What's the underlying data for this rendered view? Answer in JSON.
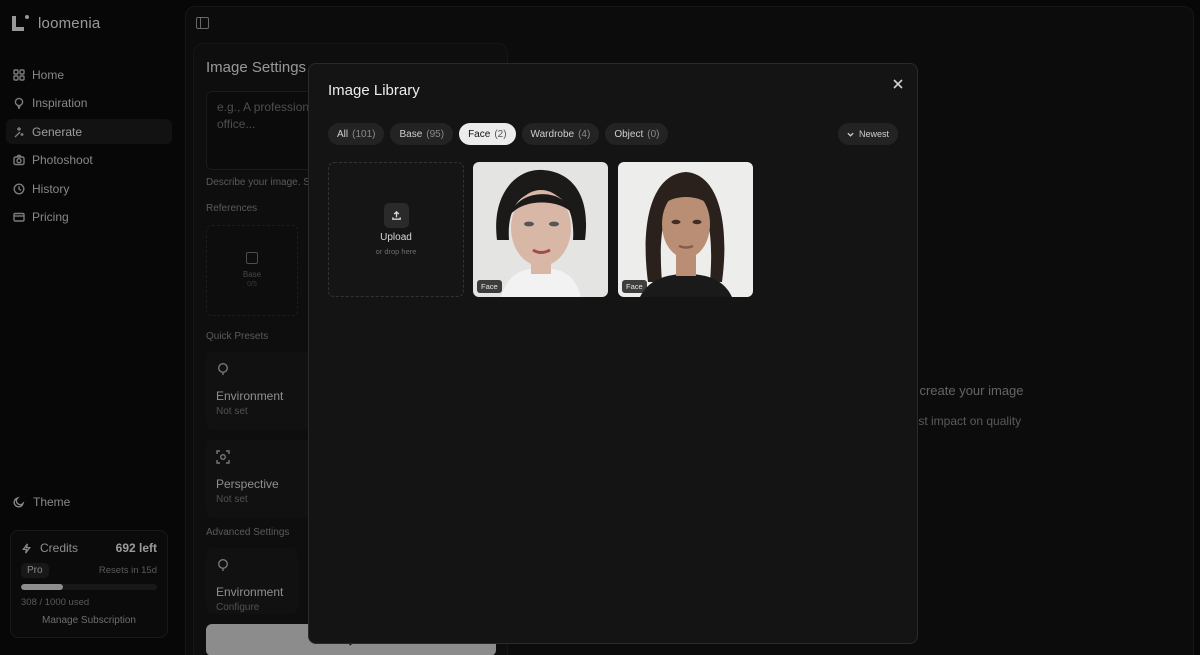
{
  "app": {
    "name": "loomenia"
  },
  "sidebar": {
    "items": [
      {
        "label": "Home",
        "icon": "grid-icon",
        "active": false
      },
      {
        "label": "Inspiration",
        "icon": "bulb-icon",
        "active": false
      },
      {
        "label": "Generate",
        "icon": "sparkle-icon",
        "active": true
      },
      {
        "label": "Photoshoot",
        "icon": "camera-icon",
        "active": false
      },
      {
        "label": "History",
        "icon": "clock-icon",
        "active": false
      },
      {
        "label": "Pricing",
        "icon": "card-icon",
        "active": false
      }
    ],
    "theme_label": "Theme",
    "credits": {
      "label": "Credits",
      "left": "692 left",
      "plan": "Pro",
      "resets": "Resets in 15d",
      "used_text": "308 / 1000 used",
      "used_fraction": 0.308,
      "manage_label": "Manage Subscription"
    }
  },
  "settings": {
    "title": "Image Settings",
    "prompt_placeholder": "e.g., A profession\noffice...",
    "describe_hint": "Describe your image. S",
    "references_label": "References",
    "ref_card": {
      "title": "Base",
      "count": "0/5"
    },
    "quick_presets_label": "Quick Presets",
    "presets": [
      {
        "title": "Environment",
        "value": "Not set"
      },
      {
        "title": "Perspective",
        "value": "Not set"
      }
    ],
    "advanced_label": "Advanced Settings",
    "advanced": {
      "title": "Environment",
      "value": "Configure"
    }
  },
  "empty_state": {
    "title": "e",
    "subtitle": "to create your image",
    "tip": "gest impact on quality"
  },
  "modal": {
    "title": "Image Library",
    "filters": [
      {
        "label": "All",
        "count": "(101)",
        "active": false
      },
      {
        "label": "Base",
        "count": "(95)",
        "active": false
      },
      {
        "label": "Face",
        "count": "(2)",
        "active": true
      },
      {
        "label": "Wardrobe",
        "count": "(4)",
        "active": false
      },
      {
        "label": "Object",
        "count": "(0)",
        "active": false
      }
    ],
    "sort_label": "Newest",
    "upload": {
      "title": "Upload",
      "hint": "or drop here"
    },
    "images": [
      {
        "tag": "Face",
        "background": "#e4e4e2",
        "hair": "#1c1a19",
        "skin": "#d9b7a6",
        "cloth": "#f2f2f2"
      },
      {
        "tag": "Face",
        "background": "#ededec",
        "hair": "#2a211c",
        "skin": "#b98e74",
        "cloth": "#1a1a1a"
      }
    ]
  }
}
